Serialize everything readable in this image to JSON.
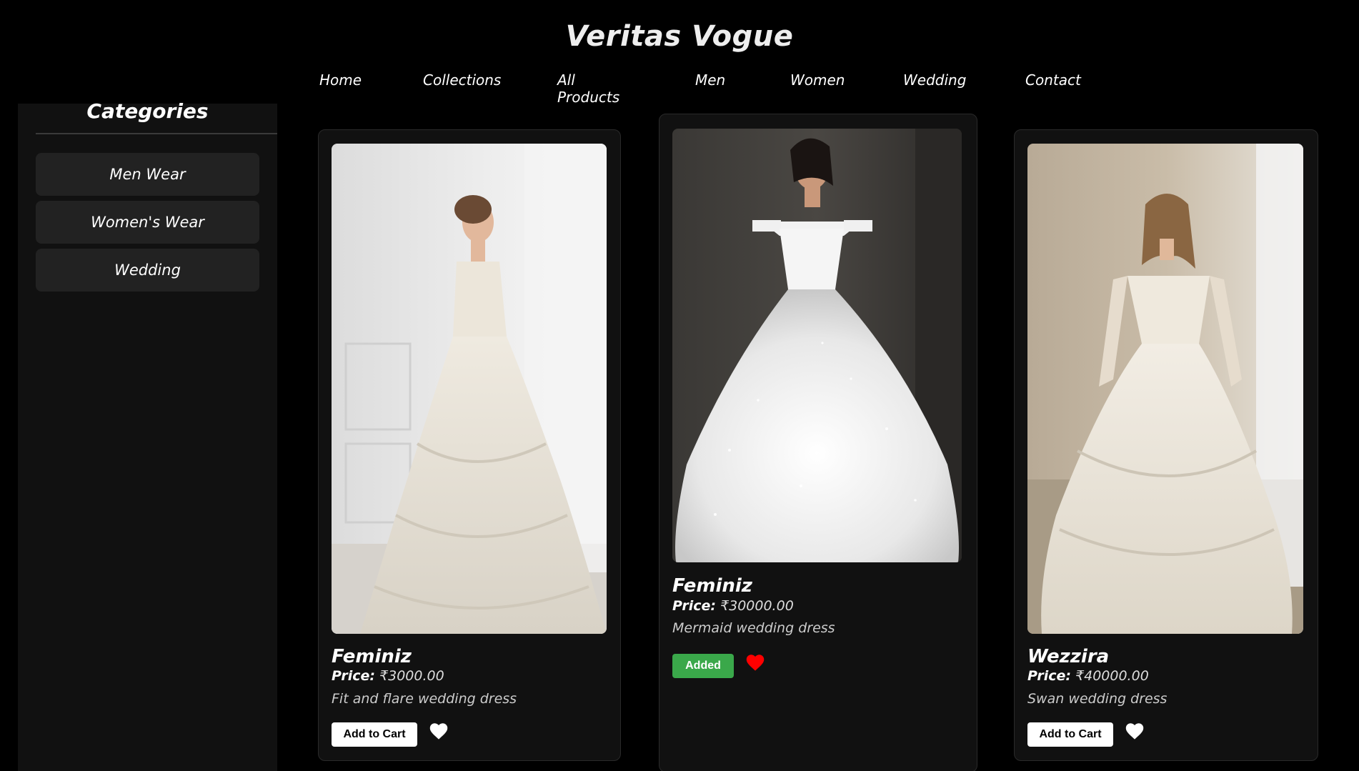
{
  "site": {
    "title": "Veritas Vogue"
  },
  "nav": {
    "items": [
      "Home",
      "Collections",
      "All Products",
      "Men",
      "Women",
      "Wedding",
      "Contact"
    ]
  },
  "sidebar": {
    "title": "Categories",
    "items": [
      "Men Wear",
      "Women's Wear",
      "Wedding"
    ]
  },
  "products": [
    {
      "name": "Feminiz",
      "price_label": "Price:",
      "price": "₹3000.00",
      "description": "Fit and flare wedding dress",
      "button_label": "Add to Cart",
      "favorited": false
    },
    {
      "name": "Feminiz",
      "price_label": "Price:",
      "price": "₹30000.00",
      "description": "Mermaid wedding dress",
      "button_label": "Added",
      "favorited": true
    },
    {
      "name": "Wezzira",
      "price_label": "Price:",
      "price": "₹40000.00",
      "description": "Swan wedding dress",
      "button_label": "Add to Cart",
      "favorited": false
    }
  ],
  "colors": {
    "background": "#000000",
    "card": "#111111",
    "added_button": "#3aa84a",
    "heart_active": "#ff0000",
    "heart_inactive": "#ffffff"
  }
}
